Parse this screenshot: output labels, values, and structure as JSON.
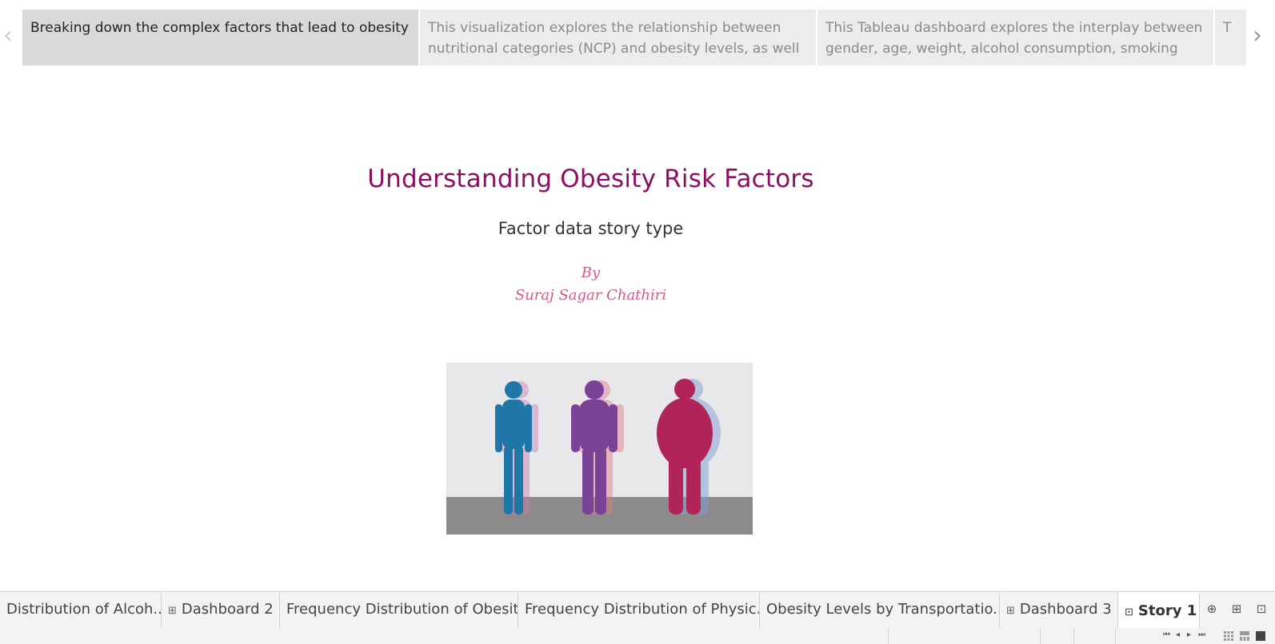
{
  "story_nav": {
    "prev_arrow": "‹",
    "next_arrow": "›",
    "points": [
      {
        "text": "Breaking down the complex factors that lead to obesity",
        "active": true
      },
      {
        "text": "This visualization explores the relationship between nutritional categories (NCP) and obesity levels, as well",
        "active": false
      },
      {
        "text": "This Tableau dashboard explores the interplay between gender, age, weight, alcohol consumption, smoking",
        "active": false
      },
      {
        "text": "T",
        "active": false
      }
    ]
  },
  "story": {
    "title": "Understanding Obesity Risk Factors",
    "subtitle": "Factor data story type",
    "by": "By",
    "author": "Suraj Sagar Chathiri"
  },
  "figure_colors": {
    "thin": "#1f77a8",
    "medium": "#7b4396",
    "heavy": "#b0245a",
    "background": "#e8e7ea",
    "floor": "#8c8a8b"
  },
  "sheet_tabs": [
    {
      "label": "Distribution of Alcoh...",
      "icon": ""
    },
    {
      "label": "Dashboard 2",
      "icon": "dashboard-icon"
    },
    {
      "label": "Frequency Distribution of Obesit...",
      "icon": ""
    },
    {
      "label": "Frequency Distribution of Physic...",
      "icon": ""
    },
    {
      "label": "Obesity Levels by Transportatio...",
      "icon": ""
    },
    {
      "label": "Dashboard 3",
      "icon": "dashboard-icon"
    },
    {
      "label": "Story 1",
      "icon": "story-icon",
      "active": true
    }
  ]
}
